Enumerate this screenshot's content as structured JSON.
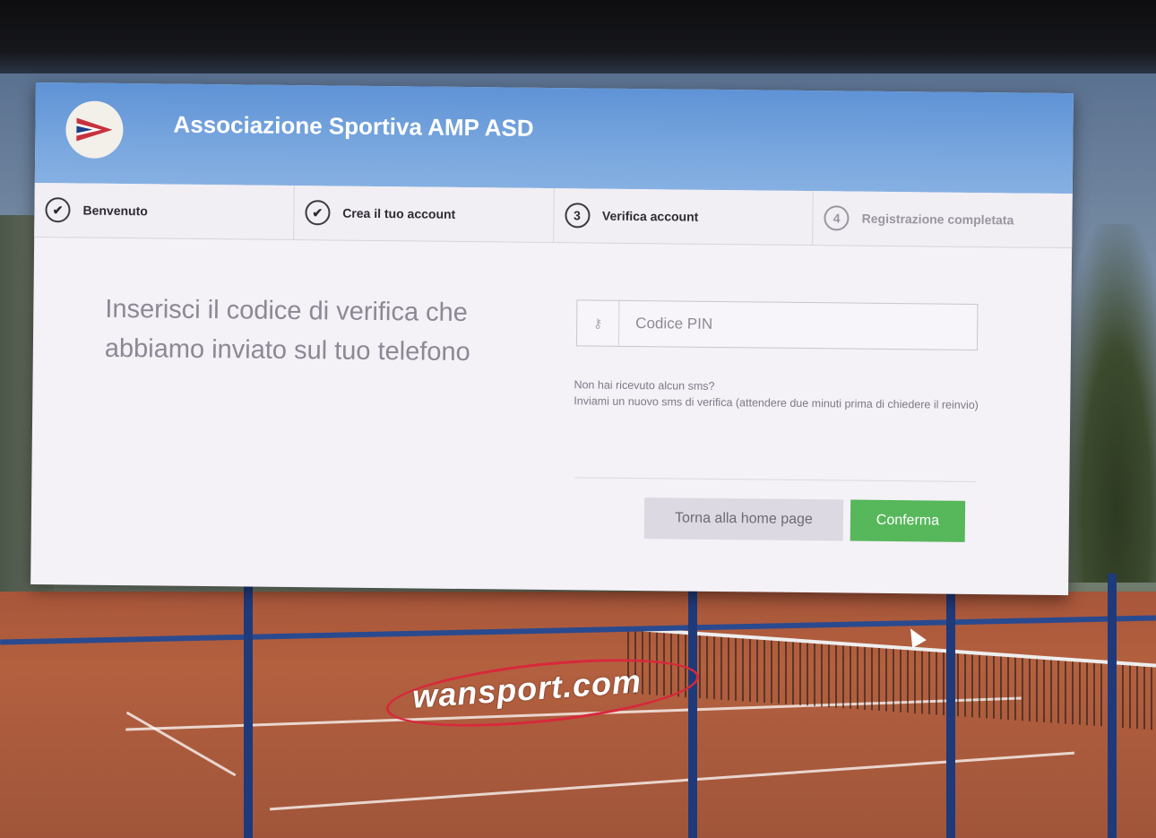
{
  "header": {
    "club_name": "Associazione Sportiva AMP ASD"
  },
  "steps": [
    {
      "number": "✔",
      "label": "Benvenuto",
      "state": "completed"
    },
    {
      "number": "✔",
      "label": "Crea il tuo account",
      "state": "completed"
    },
    {
      "number": "3",
      "label": "Verifica account",
      "state": "current"
    },
    {
      "number": "4",
      "label": "Registrazione completata",
      "state": "pending"
    }
  ],
  "main": {
    "instructions": "Inserisci il codice di verifica che abbiamo inviato sul tuo telefono",
    "pin_field": {
      "placeholder": "Codice PIN",
      "value": "",
      "icon": "key-icon"
    },
    "resend_question": "Non hai ricevuto alcun sms?",
    "resend_link": "Inviami un nuovo sms di verifica (attendere due minuti prima di chiedere il reinvio)",
    "back_button": "Torna alla home page",
    "confirm_button": "Conferma"
  },
  "footer": {
    "brand": "wansport.com"
  },
  "colors": {
    "header_blue": "#6c9cdc",
    "confirm_green": "#57b75b",
    "card_bg": "#f4f1f7"
  }
}
